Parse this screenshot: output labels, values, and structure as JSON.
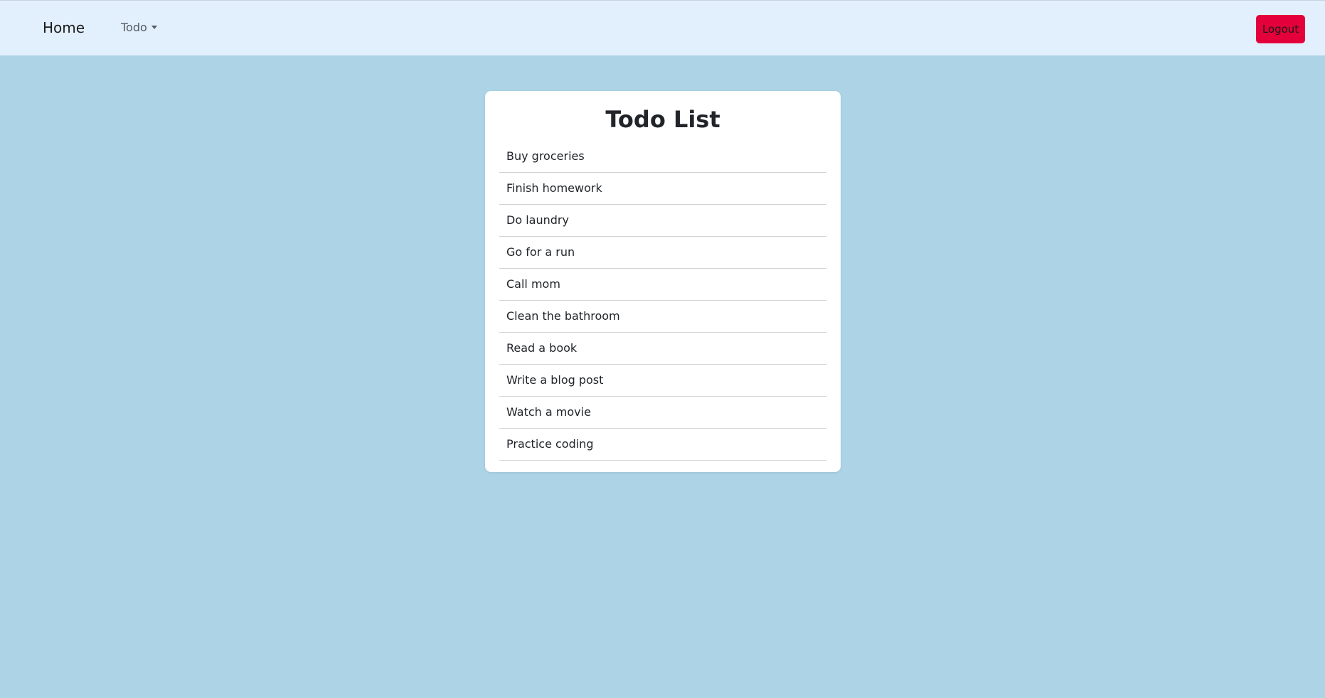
{
  "navbar": {
    "brand": "Home",
    "todo_menu": "Todo",
    "logout_label": "Logout"
  },
  "todo": {
    "title": "Todo List",
    "items": [
      "Buy groceries",
      "Finish homework",
      "Do laundry",
      "Go for a run",
      "Call mom",
      "Clean the bathroom",
      "Read a book",
      "Write a blog post",
      "Watch a movie",
      "Practice coding"
    ]
  },
  "colors": {
    "page_background": "#acd4e6",
    "navbar_background": "#e2effc",
    "logout_button": "#e4003a",
    "card_background": "#ffffff"
  },
  "icons": {
    "dropdown": "caret-down-icon"
  }
}
